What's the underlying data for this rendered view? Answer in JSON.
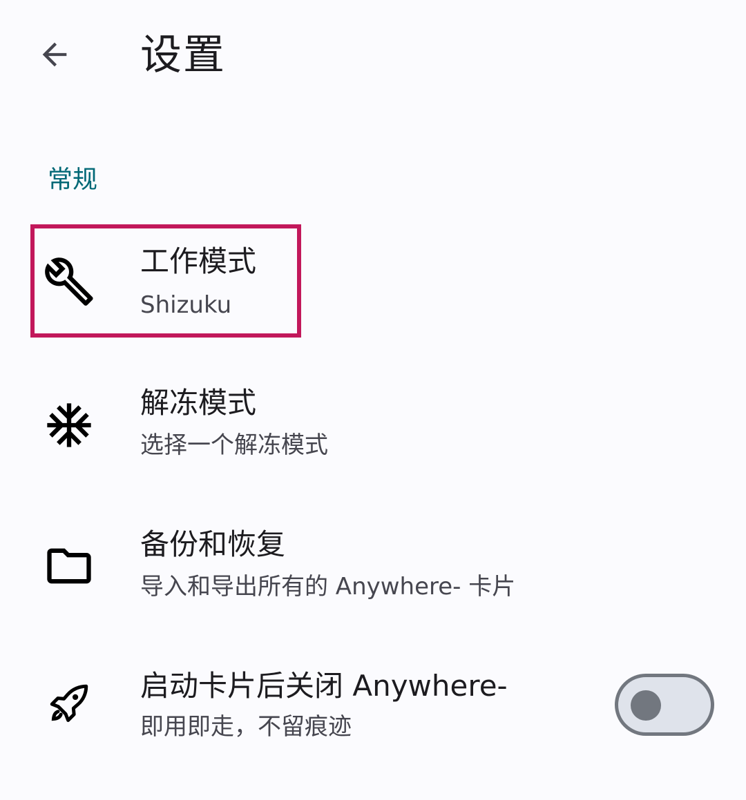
{
  "toolbar": {
    "back_icon": "arrow-back-icon",
    "title": "设置"
  },
  "section": {
    "header": "常规"
  },
  "items": [
    {
      "icon": "wrench-icon",
      "title": "工作模式",
      "summary": "Shizuku",
      "highlighted": true
    },
    {
      "icon": "snowflake-icon",
      "title": "解冻模式",
      "summary": "选择一个解冻模式"
    },
    {
      "icon": "folder-icon",
      "title": "备份和恢复",
      "summary": "导入和导出所有的 Anywhere- 卡片"
    },
    {
      "icon": "rocket-icon",
      "title": "启动卡片后关闭 Anywhere-",
      "summary": "即用即走，不留痕迹",
      "switch_checked": false
    }
  ],
  "colors": {
    "background": "#fbfbfe",
    "accent": "#006876",
    "highlight": "#c2185b",
    "switch_outline": "#72777f",
    "switch_track": "#dfe3eb"
  }
}
